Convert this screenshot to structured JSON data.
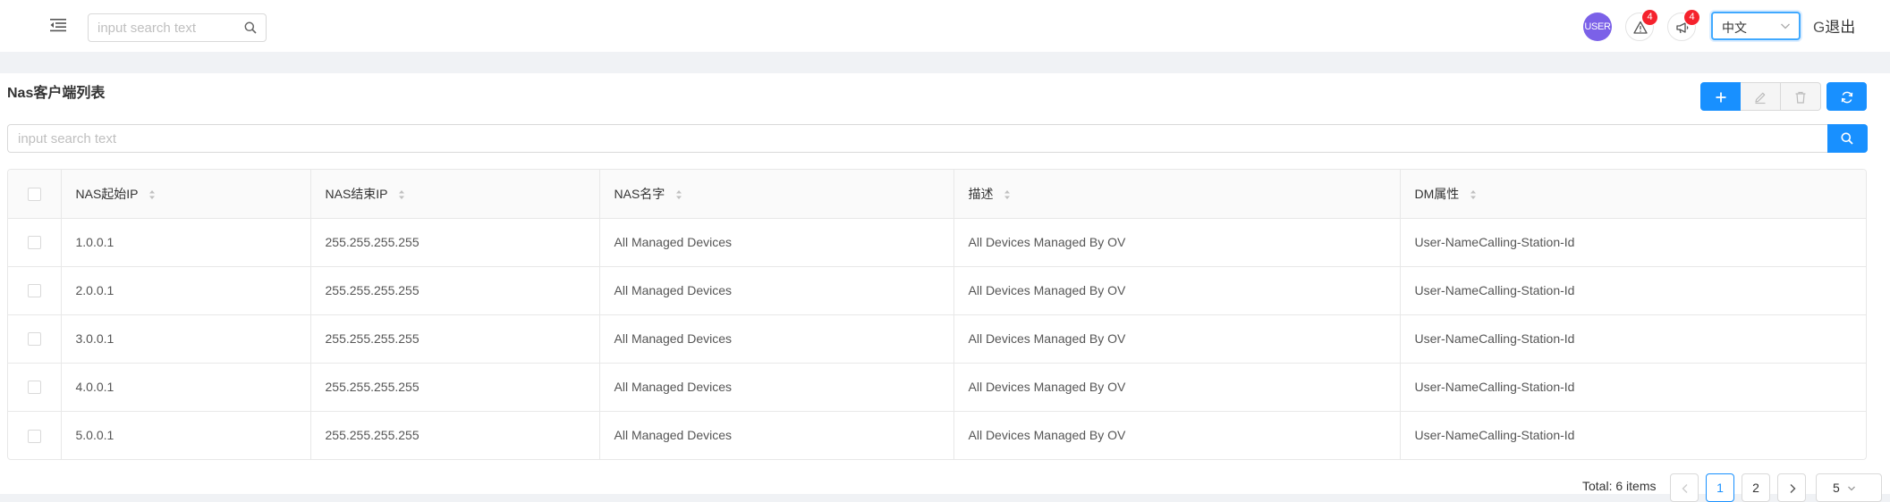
{
  "header": {
    "search_placeholder": "input search text",
    "avatar_text": "USER",
    "alerts_badge": "4",
    "notices_badge": "4",
    "language": "中文",
    "logout_icon": "G",
    "logout_label": "退出"
  },
  "page": {
    "title": "Nas客户端列表",
    "search_placeholder": "input search text"
  },
  "table": {
    "columns": [
      "NAS起始IP",
      "NAS结束IP",
      "NAS名字",
      "描述",
      "DM属性"
    ],
    "rows": [
      [
        "1.0.0.1",
        "255.255.255.255",
        "All Managed Devices",
        "All Devices Managed By OV",
        "User-NameCalling-Station-Id"
      ],
      [
        "2.0.0.1",
        "255.255.255.255",
        "All Managed Devices",
        "All Devices Managed By OV",
        "User-NameCalling-Station-Id"
      ],
      [
        "3.0.0.1",
        "255.255.255.255",
        "All Managed Devices",
        "All Devices Managed By OV",
        "User-NameCalling-Station-Id"
      ],
      [
        "4.0.0.1",
        "255.255.255.255",
        "All Managed Devices",
        "All Devices Managed By OV",
        "User-NameCalling-Station-Id"
      ],
      [
        "5.0.0.1",
        "255.255.255.255",
        "All Managed Devices",
        "All Devices Managed By OV",
        "User-NameCalling-Station-Id"
      ]
    ]
  },
  "pagination": {
    "total": "Total: 6 items",
    "pages": [
      "1",
      "2"
    ],
    "current_page": "1",
    "page_size": "5"
  },
  "colors": {
    "primary": "#1890ff",
    "badge": "#f5222d",
    "avatar": "#7b61e8"
  }
}
